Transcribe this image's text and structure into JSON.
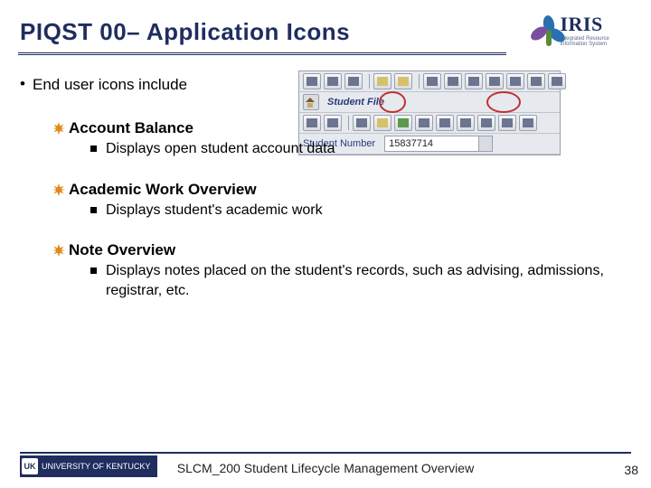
{
  "title": "PIQST 00– Application Icons",
  "logo": {
    "name": "IRIS",
    "tagline": "Integrated Resource Information System"
  },
  "sap_mock": {
    "window_title": "Student File",
    "field_label": "Student Number",
    "field_value": "15837714"
  },
  "bullets": {
    "lead": "End user icons include",
    "items": [
      {
        "title": "Account Balance",
        "detail": "Displays open student account data"
      },
      {
        "title": "Academic Work Overview",
        "detail": "Displays student's academic work"
      },
      {
        "title": "Note Overview",
        "detail": "Displays notes placed on the student's records, such as advising, admissions, registrar, etc."
      }
    ]
  },
  "footer": {
    "org_short": "UK",
    "org_long": "UNIVERSITY OF KENTUCKY",
    "center": "SLCM_200 Student Lifecycle Management Overview",
    "page": "38"
  }
}
